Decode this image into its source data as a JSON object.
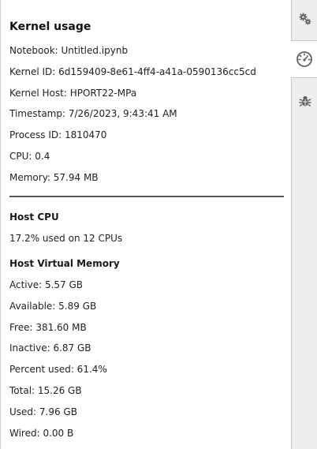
{
  "kernel_usage": {
    "title": "Kernel usage",
    "notebook": "Notebook: Untitled.ipynb",
    "kernel_id": "Kernel ID: 6d159409-8e61-4ff4-a41a-0590136cc5cd",
    "kernel_host": "Kernel Host: HPORT22-MPa",
    "timestamp": "Timestamp: 7/26/2023, 9:43:41 AM",
    "process_id": "Process ID: 1810470",
    "cpu": "CPU: 0.4",
    "memory": "Memory: 57.94 MB"
  },
  "host_cpu": {
    "heading": "Host CPU",
    "usage": "17.2% used on 12 CPUs"
  },
  "host_virtual_memory": {
    "heading": "Host Virtual Memory",
    "active": "Active: 5.57 GB",
    "available": "Available: 5.89 GB",
    "free": "Free: 381.60 MB",
    "inactive": "Inactive: 6.87 GB",
    "percent_used": "Percent used: 61.4%",
    "total": "Total: 15.26 GB",
    "used": "Used: 7.96 GB",
    "wired": "Wired: 0.00 B"
  },
  "sidebar": {
    "tabs": [
      {
        "icon": "gears-icon",
        "active": false
      },
      {
        "icon": "gauge-icon",
        "active": true
      },
      {
        "icon": "bug-icon",
        "active": false
      }
    ]
  }
}
